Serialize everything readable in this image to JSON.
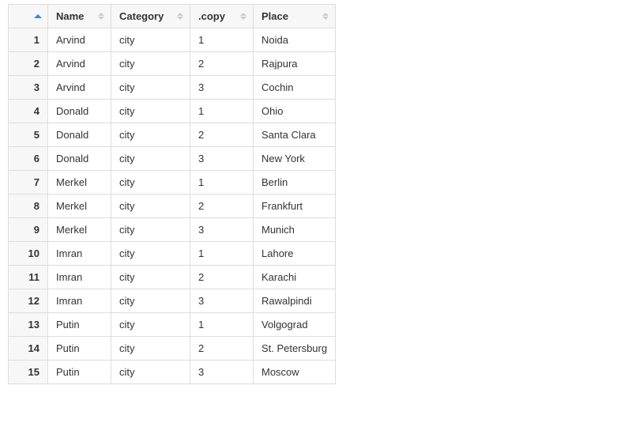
{
  "table": {
    "headers": {
      "name": "Name",
      "category": "Category",
      "copy": ".copy",
      "place": "Place"
    },
    "rows": [
      {
        "idx": "1",
        "name": "Arvind",
        "category": "city",
        "copy": "1",
        "place": "Noida"
      },
      {
        "idx": "2",
        "name": "Arvind",
        "category": "city",
        "copy": "2",
        "place": "Rajpura"
      },
      {
        "idx": "3",
        "name": "Arvind",
        "category": "city",
        "copy": "3",
        "place": "Cochin"
      },
      {
        "idx": "4",
        "name": "Donald",
        "category": "city",
        "copy": "1",
        "place": "Ohio"
      },
      {
        "idx": "5",
        "name": "Donald",
        "category": "city",
        "copy": "2",
        "place": "Santa Clara"
      },
      {
        "idx": "6",
        "name": "Donald",
        "category": "city",
        "copy": "3",
        "place": "New York"
      },
      {
        "idx": "7",
        "name": "Merkel",
        "category": "city",
        "copy": "1",
        "place": "Berlin"
      },
      {
        "idx": "8",
        "name": "Merkel",
        "category": "city",
        "copy": "2",
        "place": "Frankfurt"
      },
      {
        "idx": "9",
        "name": "Merkel",
        "category": "city",
        "copy": "3",
        "place": "Munich"
      },
      {
        "idx": "10",
        "name": "Imran",
        "category": "city",
        "copy": "1",
        "place": "Lahore"
      },
      {
        "idx": "11",
        "name": "Imran",
        "category": "city",
        "copy": "2",
        "place": "Karachi"
      },
      {
        "idx": "12",
        "name": "Imran",
        "category": "city",
        "copy": "3",
        "place": "Rawalpindi"
      },
      {
        "idx": "13",
        "name": "Putin",
        "category": "city",
        "copy": "1",
        "place": "Volgograd"
      },
      {
        "idx": "14",
        "name": "Putin",
        "category": "city",
        "copy": "2",
        "place": "St. Petersburg"
      },
      {
        "idx": "15",
        "name": "Putin",
        "category": "city",
        "copy": "3",
        "place": "Moscow"
      }
    ]
  }
}
